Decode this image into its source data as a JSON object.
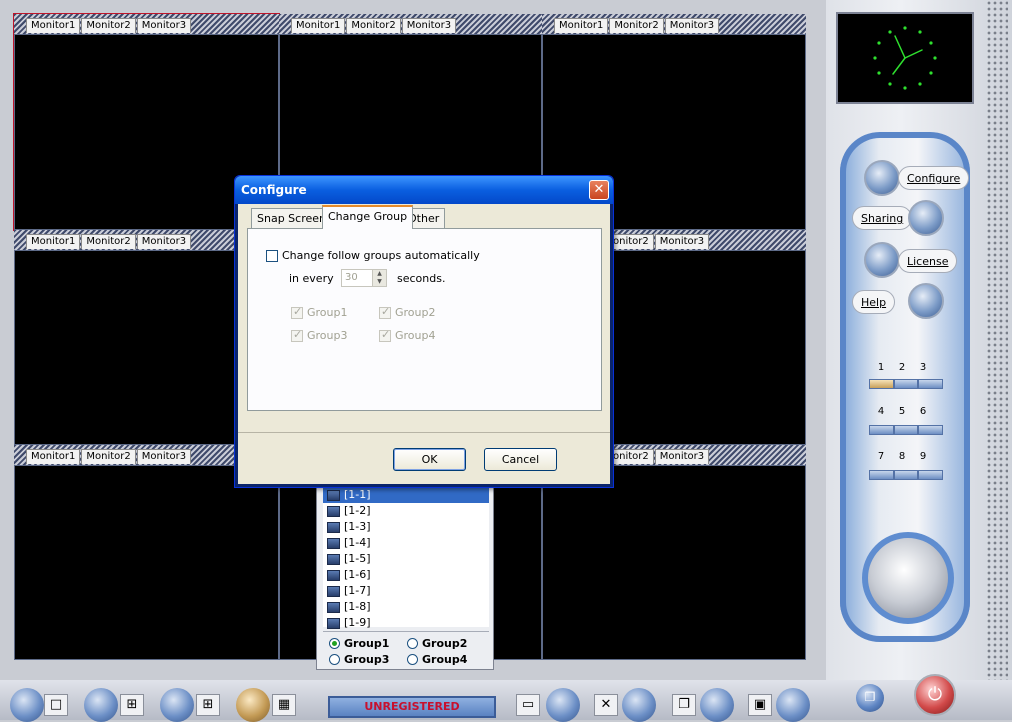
{
  "monitor_tabs": [
    "Monitor1",
    "Monitor2",
    "Monitor3"
  ],
  "partial_tabs": [
    "onitor2",
    "Monitor3"
  ],
  "control_panel": {
    "configure_label": "Configure",
    "sharing_label": "Sharing",
    "license_label": "License",
    "help_label": "Help",
    "layout_numbers": [
      "1",
      "2",
      "3",
      "4",
      "5",
      "6",
      "7",
      "8",
      "9"
    ],
    "active_layout": "1"
  },
  "bottom_bar": {
    "status_text": "UNREGISTERED"
  },
  "device_list": {
    "items": [
      "[1-1]",
      "[1-2]",
      "[1-3]",
      "[1-4]",
      "[1-5]",
      "[1-6]",
      "[1-7]",
      "[1-8]",
      "[1-9]"
    ],
    "selected": "[1-1]",
    "groups": [
      "Group1",
      "Group2",
      "Group3",
      "Group4"
    ],
    "selected_group": "Group1"
  },
  "dialog": {
    "title": "Configure",
    "tabs": [
      "Snap Screen",
      "Change Group",
      "Other"
    ],
    "active_tab": "Change Group",
    "auto_change_label": "Change follow groups automatically",
    "auto_change_checked": false,
    "in_every_label": "in every",
    "interval_value": "30",
    "seconds_label": "seconds.",
    "group_checks": [
      {
        "label": "Group1",
        "checked": true
      },
      {
        "label": "Group2",
        "checked": true
      },
      {
        "label": "Group3",
        "checked": true
      },
      {
        "label": "Group4",
        "checked": true
      }
    ],
    "ok_label": "OK",
    "cancel_label": "Cancel"
  },
  "colors": {
    "selection_red": "#c0152a",
    "xp_blue": "#0a5fe0",
    "unregistered_red": "#c8102e"
  }
}
